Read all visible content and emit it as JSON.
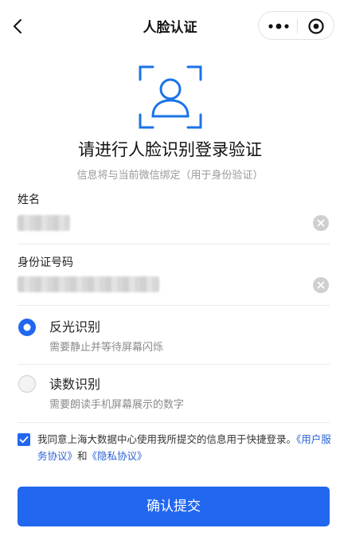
{
  "nav": {
    "title": "人脸认证",
    "back_icon": "chevron-left-icon",
    "more_icon": "more-dots-icon",
    "close_icon": "target-close-icon"
  },
  "hero": {
    "icon": "face-scan-icon",
    "headline": "请进行人脸识别登录验证",
    "subline": "信息将与当前微信绑定（用于身份验证）"
  },
  "form": {
    "name_label": "姓名",
    "id_label": "身份证号码"
  },
  "options": [
    {
      "title": "反光识别",
      "desc": "需要静止并等待屏幕闪烁",
      "selected": true
    },
    {
      "title": "读数识别",
      "desc": "需要朗读手机屏幕展示的数字",
      "selected": false
    }
  ],
  "agreement": {
    "checked": true,
    "text": "我同意上海大数据中心使用我所提交的信息用于快捷登录。",
    "link_user": "《用户服务协议》",
    "and": "和",
    "link_privacy": "《隐私协议》"
  },
  "submit_label": "确认提交",
  "colors": {
    "accent": "#2167f0",
    "link": "#2a62d6",
    "icon_blue": "#1a73e8"
  }
}
